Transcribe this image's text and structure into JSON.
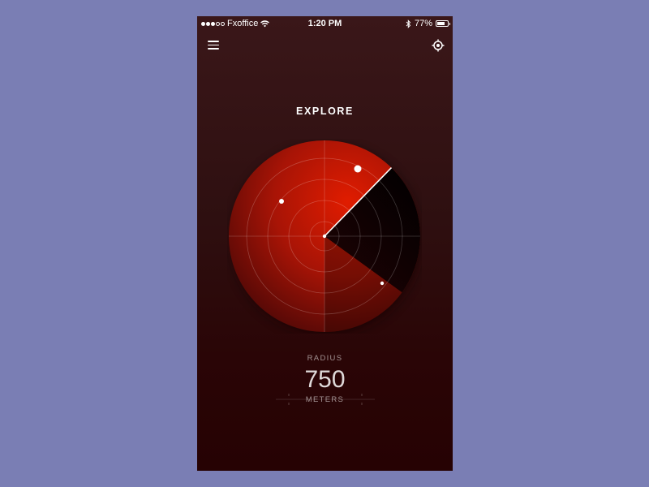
{
  "status_bar": {
    "carrier": "Fxoffice",
    "signal_filled": 3,
    "signal_total": 5,
    "time": "1:20 PM",
    "battery": "77%",
    "battery_level": 0.77
  },
  "header": {
    "title": "EXPLORE"
  },
  "icons": {
    "menu": "hamburger-menu-icon",
    "locate": "crosshair-target-icon",
    "wifi": "wifi-icon",
    "bluetooth": "bluetooth-icon",
    "battery": "battery-icon"
  },
  "radius": {
    "label": "RADIUS",
    "value": "750",
    "unit": "METERS"
  },
  "colors": {
    "background": "#7a7eb4",
    "accent": "#d41a00",
    "sweep_line": "#ffffff",
    "screen_dark": "#2a0506"
  }
}
